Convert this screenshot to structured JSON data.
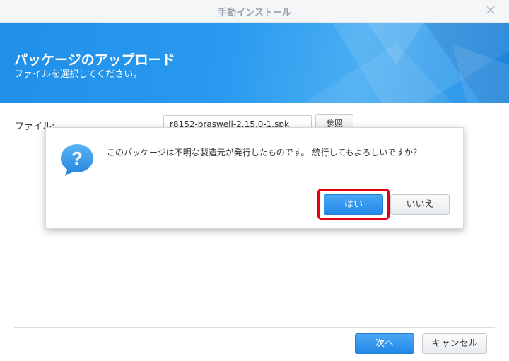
{
  "window": {
    "title": "手動インストール",
    "close_icon": "close-icon"
  },
  "banner": {
    "heading": "パッケージのアップロード",
    "subheading": "ファイルを選択してください。"
  },
  "form": {
    "file_label": "ファイル:",
    "file_value": "r8152-braswell-2.15.0-1.spk",
    "browse_label": "参照"
  },
  "footer": {
    "next_label": "次へ",
    "cancel_label": "キャンセル"
  },
  "dialog": {
    "icon": "question-icon",
    "message": "このパッケージは不明な製造元が発行したものです。 続行してもよろしいですか？",
    "yes_label": "はい",
    "no_label": "いいえ"
  },
  "colors": {
    "accent": "#2288e8",
    "highlight": "#e60012",
    "banner": "#1f8fe8"
  }
}
